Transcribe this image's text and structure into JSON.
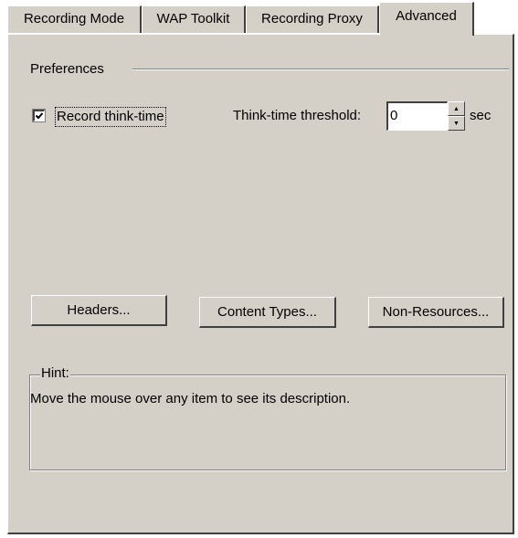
{
  "tabs": [
    {
      "label": "Recording Mode"
    },
    {
      "label": "WAP Toolkit"
    },
    {
      "label": "Recording Proxy"
    },
    {
      "label": "Advanced",
      "active": true
    }
  ],
  "preferences": {
    "group_label": "Preferences",
    "record_think_time": {
      "label": "Record think-time",
      "checked": true
    },
    "threshold": {
      "label": "Think-time threshold:",
      "value": "0",
      "unit": "sec"
    }
  },
  "buttons": {
    "headers": "Headers...",
    "content_types": "Content Types...",
    "non_resources": "Non-Resources..."
  },
  "hint": {
    "label": "Hint:",
    "text": "Move the mouse over any item to see its description."
  }
}
